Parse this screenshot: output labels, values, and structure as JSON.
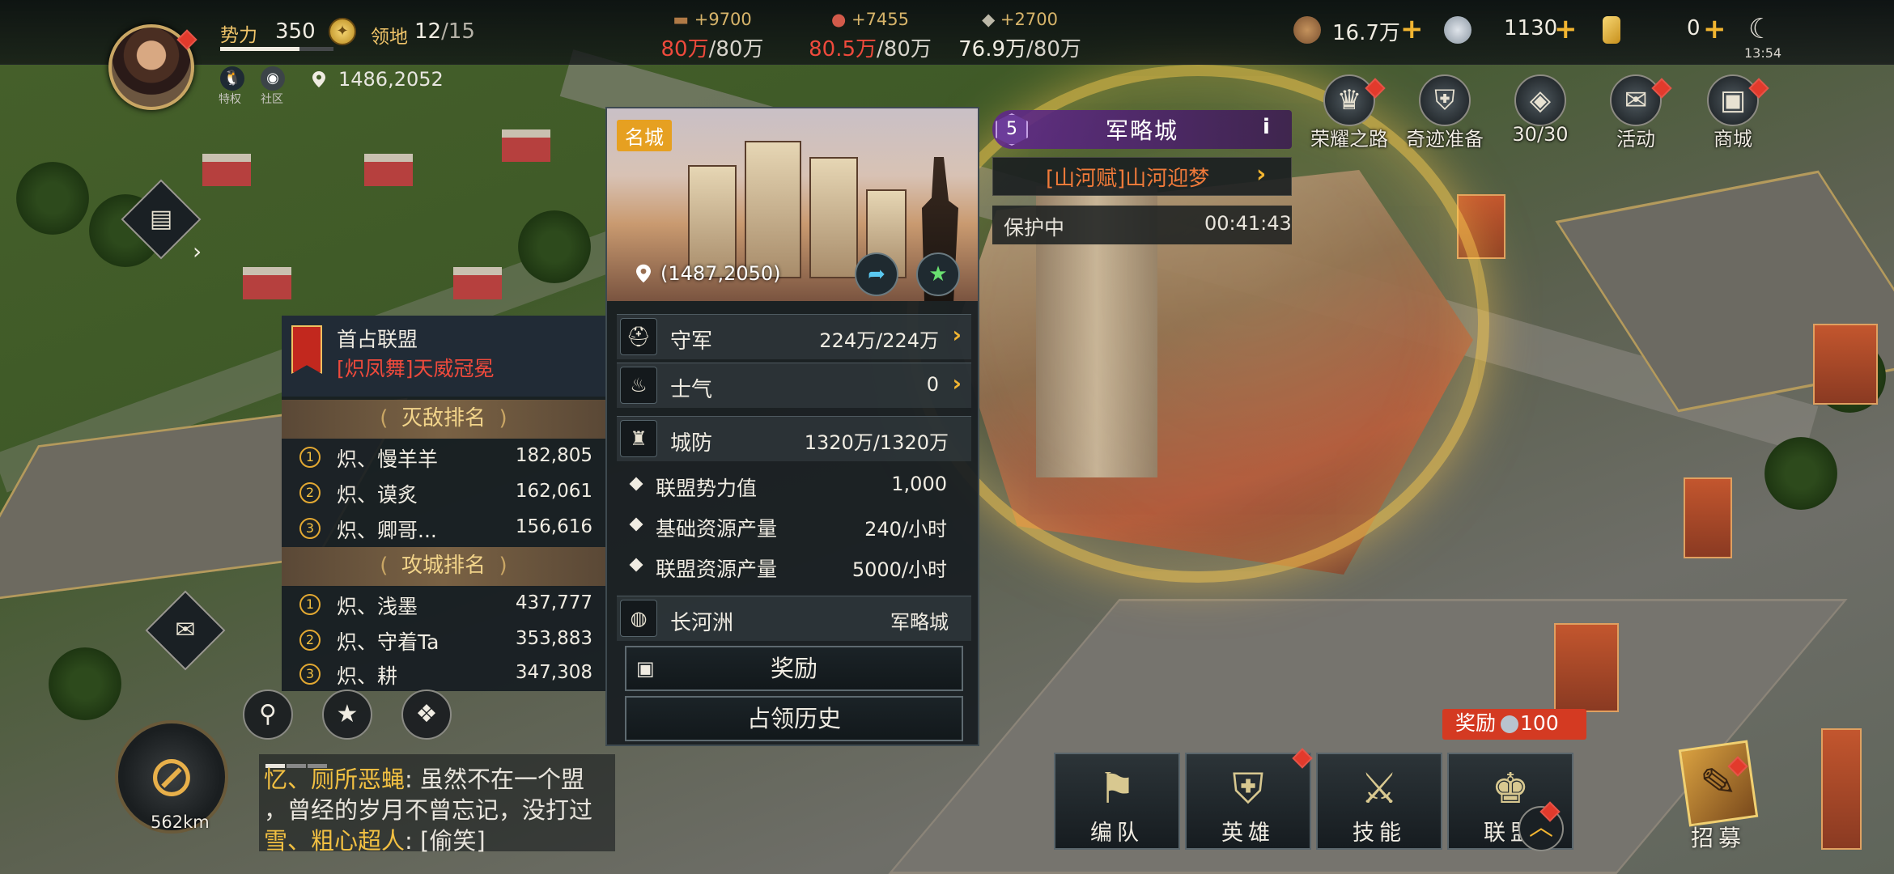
{
  "top": {
    "power_label": "势力",
    "power_value": "350",
    "land_label": "领地",
    "land_current": "12",
    "land_max": "/15",
    "perk_label": "特权",
    "community_label": "社区",
    "coords": "1486,2052",
    "resources": [
      {
        "name": "wood",
        "gain": "+9700",
        "current": "80万",
        "max": "/80万",
        "current_color": "#ef4a3c"
      },
      {
        "name": "meat",
        "gain": "+7455",
        "current": "80.5万",
        "max": "/80万",
        "current_color": "#ef4a3c"
      },
      {
        "name": "stone",
        "gain": "+2700",
        "current": "76.9万",
        "max": "/80万",
        "current_color": "#f0ece2"
      }
    ],
    "currency1": "16.7万",
    "currency2": "1130",
    "currency3": "0",
    "time": "13:54"
  },
  "menu": [
    {
      "label": "荣耀之路",
      "icon": "crown-icon"
    },
    {
      "label": "奇迹准备",
      "icon": "helmet-icon"
    },
    {
      "label": "30/30",
      "icon": "shield-icon"
    },
    {
      "label": "活动",
      "icon": "scroll-icon"
    },
    {
      "label": "商城",
      "icon": "chest-icon"
    }
  ],
  "city": {
    "tag": "名城",
    "coords": "(1487,2050)",
    "level": "5",
    "name": "军略城",
    "event": "[山河赋]山河迎梦",
    "protect_label": "保护中",
    "protect_time": "00:41:43",
    "stats": [
      {
        "label": "守军",
        "value": "224万/224万"
      },
      {
        "label": "士气",
        "value": "0"
      },
      {
        "label": "城防",
        "value": "1320万/1320万"
      }
    ],
    "sub_stats": [
      {
        "label": "联盟势力值",
        "value": "1,000"
      },
      {
        "label": "基础资源产量",
        "value": "240/小时"
      },
      {
        "label": "联盟资源产量",
        "value": "5000/小时"
      }
    ],
    "region_label": "长河洲",
    "region_value": "军略城",
    "reward_btn": "奖励",
    "history_btn": "占领历史"
  },
  "alliance": {
    "title": "首占联盟",
    "name": "[炽凤舞]天威冠冕",
    "kill_rank_title": "灭敌排名",
    "kill_rank": [
      {
        "rank": "1",
        "name": "炽、慢羊羊",
        "score": "182,805"
      },
      {
        "rank": "2",
        "name": "炽、谟炙",
        "score": "162,061"
      },
      {
        "rank": "3",
        "name": "炽、卿哥...",
        "score": "156,616"
      }
    ],
    "siege_rank_title": "攻城排名",
    "siege_rank": [
      {
        "rank": "1",
        "name": "炽、浅墨",
        "score": "437,777"
      },
      {
        "rank": "2",
        "name": "炽、守着Ta",
        "score": "353,883"
      },
      {
        "rank": "3",
        "name": "炽、耕",
        "score": "347,308"
      }
    ]
  },
  "compass": {
    "distance": "562km"
  },
  "chat": [
    {
      "who": "忆、厕所恶蝇",
      "text": ": 虽然不在一个盟"
    },
    {
      "who": "",
      "text": "，曾经的岁月不曾忘记，没打过"
    },
    {
      "who": "雪、粗心超人",
      "text": ": [偷笑]"
    }
  ],
  "bottom": {
    "reward_label": "奖励",
    "reward_value": "100",
    "buttons": [
      {
        "label": "编队",
        "icon": "flag-icon"
      },
      {
        "label": "英雄",
        "icon": "knight-helmet-icon"
      },
      {
        "label": "技能",
        "icon": "crossed-swords-icon"
      },
      {
        "label": "联盟",
        "icon": "alliance-crest-icon"
      }
    ],
    "recruit_label": "招募"
  }
}
